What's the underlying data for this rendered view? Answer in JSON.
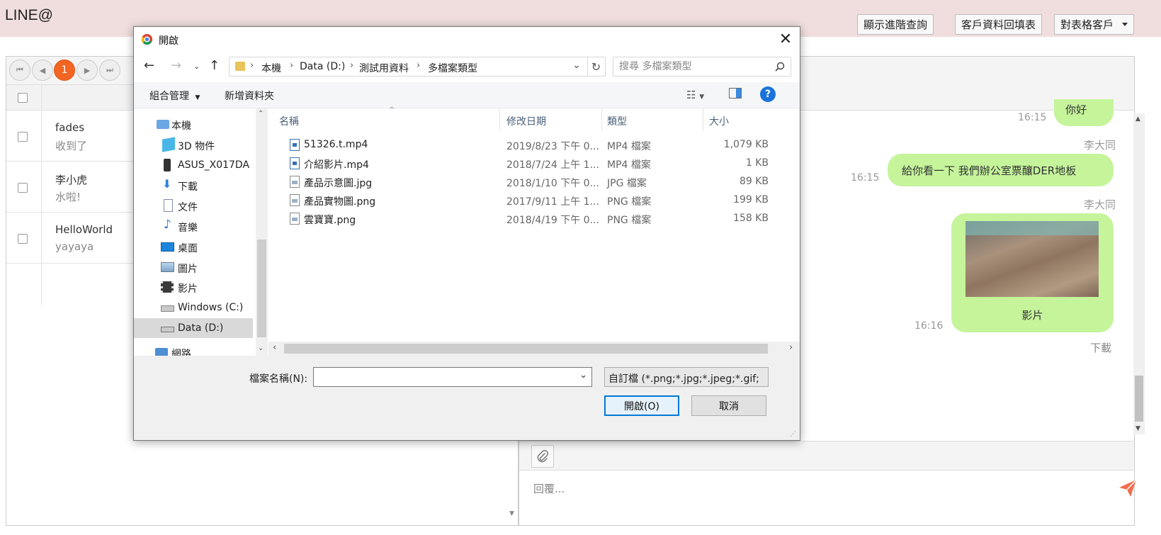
{
  "app": {
    "brand": "LINE@",
    "top_buttons": {
      "advanced_search": "顯示進階查詢",
      "fill_customer": "客戶資料回填表",
      "customer_filter": "對表格客戶"
    }
  },
  "pager": {
    "first": "⏮",
    "prev": "◀",
    "current_page": "1",
    "next": "▶",
    "last": "⏭"
  },
  "conversations": [
    {
      "name": "fades",
      "last_message": "收到了"
    },
    {
      "name": "李小虎",
      "last_message": "水啦!"
    },
    {
      "name": "HelloWorld",
      "last_message": "yayaya"
    }
  ],
  "chat": {
    "messages": [
      {
        "time": "16:15",
        "text": "你好"
      },
      {
        "sender": "李大同",
        "time": "16:15",
        "text": "給你看一下 我們辦公室票釀DER地板"
      },
      {
        "sender": "李大同",
        "time": "16:16",
        "text": "影片",
        "download": "下載"
      }
    ],
    "reply_placeholder": "回覆..."
  },
  "colors": {
    "bubble": "#c5f49b",
    "accent": "#f26522",
    "send": "#f26e4e",
    "dialog_primary": "#0078d7"
  },
  "dialog": {
    "title": "開啟",
    "close": "✕",
    "address": [
      "本機",
      "Data (D:)",
      "測試用資料",
      "多檔案類型"
    ],
    "search_placeholder": "搜尋 多檔案類型",
    "organize": "組合管理",
    "new_folder": "新增資料夾",
    "nav_items": [
      {
        "label": "本機",
        "icon": "computer-icon"
      },
      {
        "label": "3D 物件",
        "icon": "3d-objects-icon"
      },
      {
        "label": "ASUS_X017DA",
        "icon": "phone-icon"
      },
      {
        "label": "下載",
        "icon": "download-icon"
      },
      {
        "label": "文件",
        "icon": "document-icon"
      },
      {
        "label": "音樂",
        "icon": "music-icon"
      },
      {
        "label": "桌面",
        "icon": "desktop-icon"
      },
      {
        "label": "圖片",
        "icon": "pictures-icon"
      },
      {
        "label": "影片",
        "icon": "videos-icon"
      },
      {
        "label": "Windows (C:)",
        "icon": "drive-c-icon"
      },
      {
        "label": "Data (D:)",
        "icon": "drive-d-icon",
        "selected": true
      },
      {
        "label": "網路",
        "icon": "network-icon"
      }
    ],
    "columns": {
      "name": "名稱",
      "modified": "修改日期",
      "type": "類型",
      "size": "大小"
    },
    "files": [
      {
        "name": "51326.t.mp4",
        "modified": "2019/8/23 下午 0...",
        "type": "MP4 檔案",
        "size": "1,079 KB",
        "icon": "video-file-icon"
      },
      {
        "name": "介紹影片.mp4",
        "modified": "2018/7/24 上午 1...",
        "type": "MP4 檔案",
        "size": "1 KB",
        "icon": "video-file-icon"
      },
      {
        "name": "產品示意圖.jpg",
        "modified": "2018/1/10 下午 0...",
        "type": "JPG 檔案",
        "size": "89 KB",
        "icon": "image-file-icon"
      },
      {
        "name": "產品實物圖.png",
        "modified": "2017/9/11 上午 1...",
        "type": "PNG 檔案",
        "size": "199 KB",
        "icon": "image-file-icon"
      },
      {
        "name": "雲寶寶.png",
        "modified": "2018/4/19 下午 0...",
        "type": "PNG 檔案",
        "size": "158 KB",
        "icon": "image-file-icon"
      }
    ],
    "filename_label": "檔案名稱(N):",
    "filename_value": "",
    "filetype": "自訂檔 (*.png;*.jpg;*.jpeg;*.gif;",
    "open_button": "開啟(O)",
    "cancel_button": "取消"
  }
}
